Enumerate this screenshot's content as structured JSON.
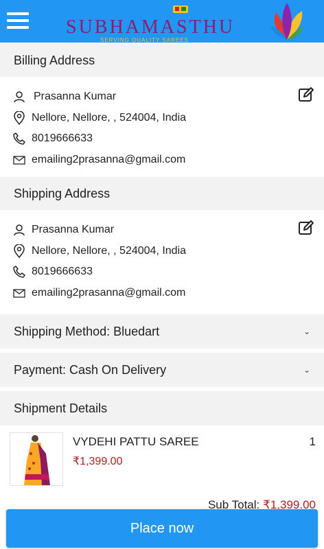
{
  "header": {
    "brand": "SUBHAMASTHU",
    "tagline": "SERVING QUALITY SAREES"
  },
  "billing": {
    "title": "Billing Address",
    "name": "Prasanna Kumar",
    "address": "Nellore, Nellore, , 524004, India",
    "phone": "8019666633",
    "email": "emailing2prasanna@gmail.com"
  },
  "shipping": {
    "title": "Shipping Address",
    "name": "Prasanna Kumar",
    "address": "Nellore, Nellore, , 524004, India",
    "phone": "8019666633",
    "email": "emailing2prasanna@gmail.com"
  },
  "shipping_method": {
    "label": "Shipping Method: Bluedart"
  },
  "payment": {
    "label": "Payment: Cash On Delivery"
  },
  "shipment": {
    "title": "Shipment Details",
    "product_name": "VYDEHI PATTU SAREE",
    "product_price": "₹1,399.00",
    "quantity": "1"
  },
  "summary": {
    "subtotal_label": "Sub Total: ",
    "subtotal_value": "₹1,399.00"
  },
  "place_button": {
    "label": "Place now"
  },
  "colors": {
    "primary": "#2196f3",
    "price": "#b71c1c",
    "section_bg": "#f2f2f2"
  }
}
